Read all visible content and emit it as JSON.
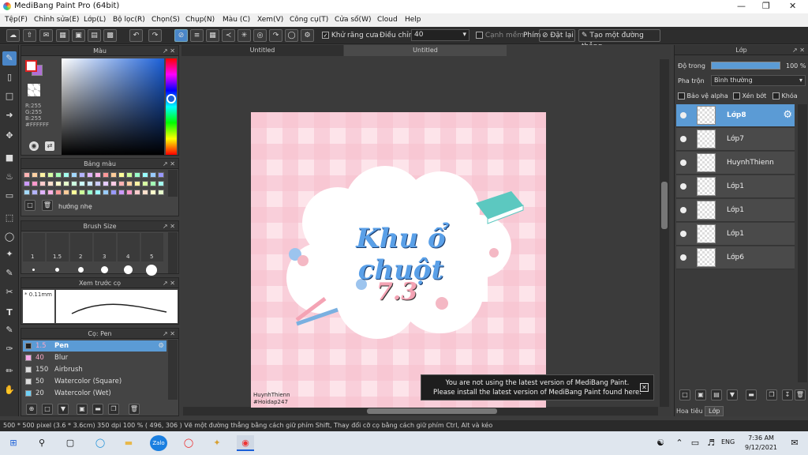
{
  "app": {
    "title": "MediBang Paint Pro (64bit)"
  },
  "menu": [
    "Tệp(F)",
    "Chỉnh sửa(E)",
    "Lớp(L)",
    "Bộ lọc(R)",
    "Chọn(S)",
    "Chụp(N)",
    "Màu (C)",
    "Xem(V)",
    "Công cụ(T)",
    "Cửa số(W)",
    "Cloud",
    "Help"
  ],
  "toolbar": {
    "antialias_label": "Khử răng cưa",
    "adjust_label": "Điều chỉnh",
    "adjust_value": "40",
    "edge_label": "Cạnh mềm",
    "key_label": "Phím",
    "reset_label": "Đặt lại",
    "straight_label": "Tạo một đường thẳng"
  },
  "color_panel": {
    "title": "Màu",
    "r": "R:255",
    "g": "G:255",
    "b": "B:255",
    "hex": "#FFFFFF"
  },
  "palette_panel": {
    "title": "Bảng màu",
    "hint": "hướng nhẹ"
  },
  "brush_size_panel": {
    "title": "Brush Size",
    "sizes": [
      "1",
      "1.5",
      "2",
      "3",
      "4",
      "5"
    ]
  },
  "preview_panel": {
    "title": "Xem trước cọ",
    "size": "0.11mm"
  },
  "brush_panel": {
    "title": "Cọ: Pen",
    "items": [
      {
        "size": "1.5",
        "name": "Pen",
        "color": "#222222"
      },
      {
        "size": "40",
        "name": "Blur",
        "color": "#f7a8e8"
      },
      {
        "size": "150",
        "name": "Airbrush",
        "color": "#dddddd"
      },
      {
        "size": "50",
        "name": "Watercolor (Square)",
        "color": "#dddddd"
      },
      {
        "size": "20",
        "name": "Watercolor (Wet)",
        "color": "#6fd0f5"
      }
    ]
  },
  "canvas": {
    "tabs": [
      "Untitled",
      "Untitled"
    ],
    "art_title": "Khu ổ chuột",
    "art_sub": "7.3",
    "watermark_line1": "HuynhThienn",
    "watermark_line2": "#Hoidap247"
  },
  "notice": {
    "line1": "You are not using the latest version of MediBang Paint.",
    "line2": "Please install the latest version of MediBang Paint found here."
  },
  "layer_panel": {
    "title": "Lớp",
    "opacity_label": "Độ trong",
    "opacity_value": "100 %",
    "blend_label": "Pha trộn",
    "blend_value": "Bình thường",
    "protect_alpha": "Bảo vệ alpha",
    "clip": "Xén bớt",
    "lock": "Khóa",
    "layers": [
      "Lớp8",
      "Lớp7",
      "HuynhThienn",
      "Lớp1",
      "Lớp1",
      "Lớp1",
      "Lớp6"
    ],
    "bottom_tabs": [
      "Hoa tiêu",
      "Lớp"
    ]
  },
  "status": {
    "text": "500 * 500 pixel   (3.6 * 3.6cm)   350 dpi   100 %   ( 496, 306 )   Vẽ một đường thẳng bằng cách giữ phím Shift, Thay đổi cỡ cọ bằng cách giữ phím Ctrl, Alt và kéo"
  },
  "taskbar": {
    "lang": "ENG",
    "time": "7:36 AM",
    "date": "9/12/2021"
  },
  "colors": {
    "accent": "#4a86c8",
    "selected_layer": "#5b9bd5",
    "title_blue": "#5aa0e8"
  }
}
